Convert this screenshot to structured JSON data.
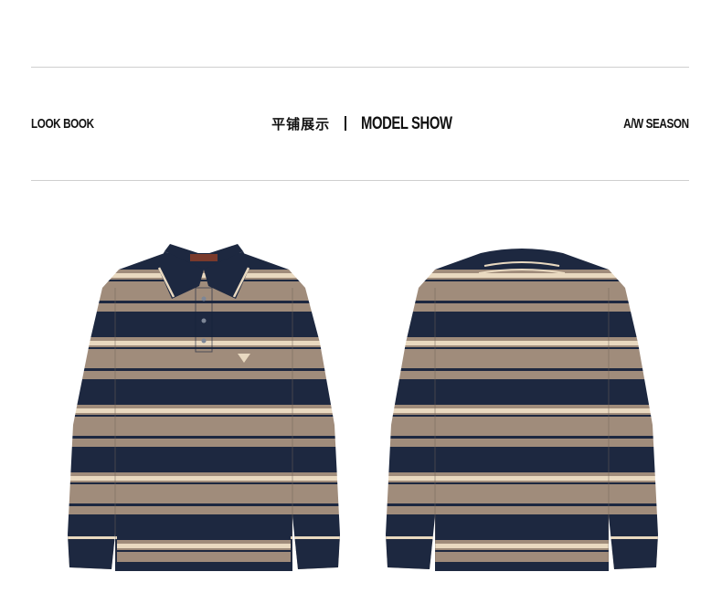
{
  "header": {
    "left_label": "LOOK BOOK",
    "center_cn": "平铺展示",
    "center_en": "MODEL SHOW",
    "right_label": "A/W SEASON"
  },
  "products": [
    {
      "view": "front",
      "collar_label": "brand-label",
      "logo": "triangle-logo"
    },
    {
      "view": "back"
    }
  ],
  "colors": {
    "khaki": "#a08c7b",
    "navy": "#1d2840",
    "cream": "#e9d9c0",
    "rule": "#cfcfcf"
  }
}
